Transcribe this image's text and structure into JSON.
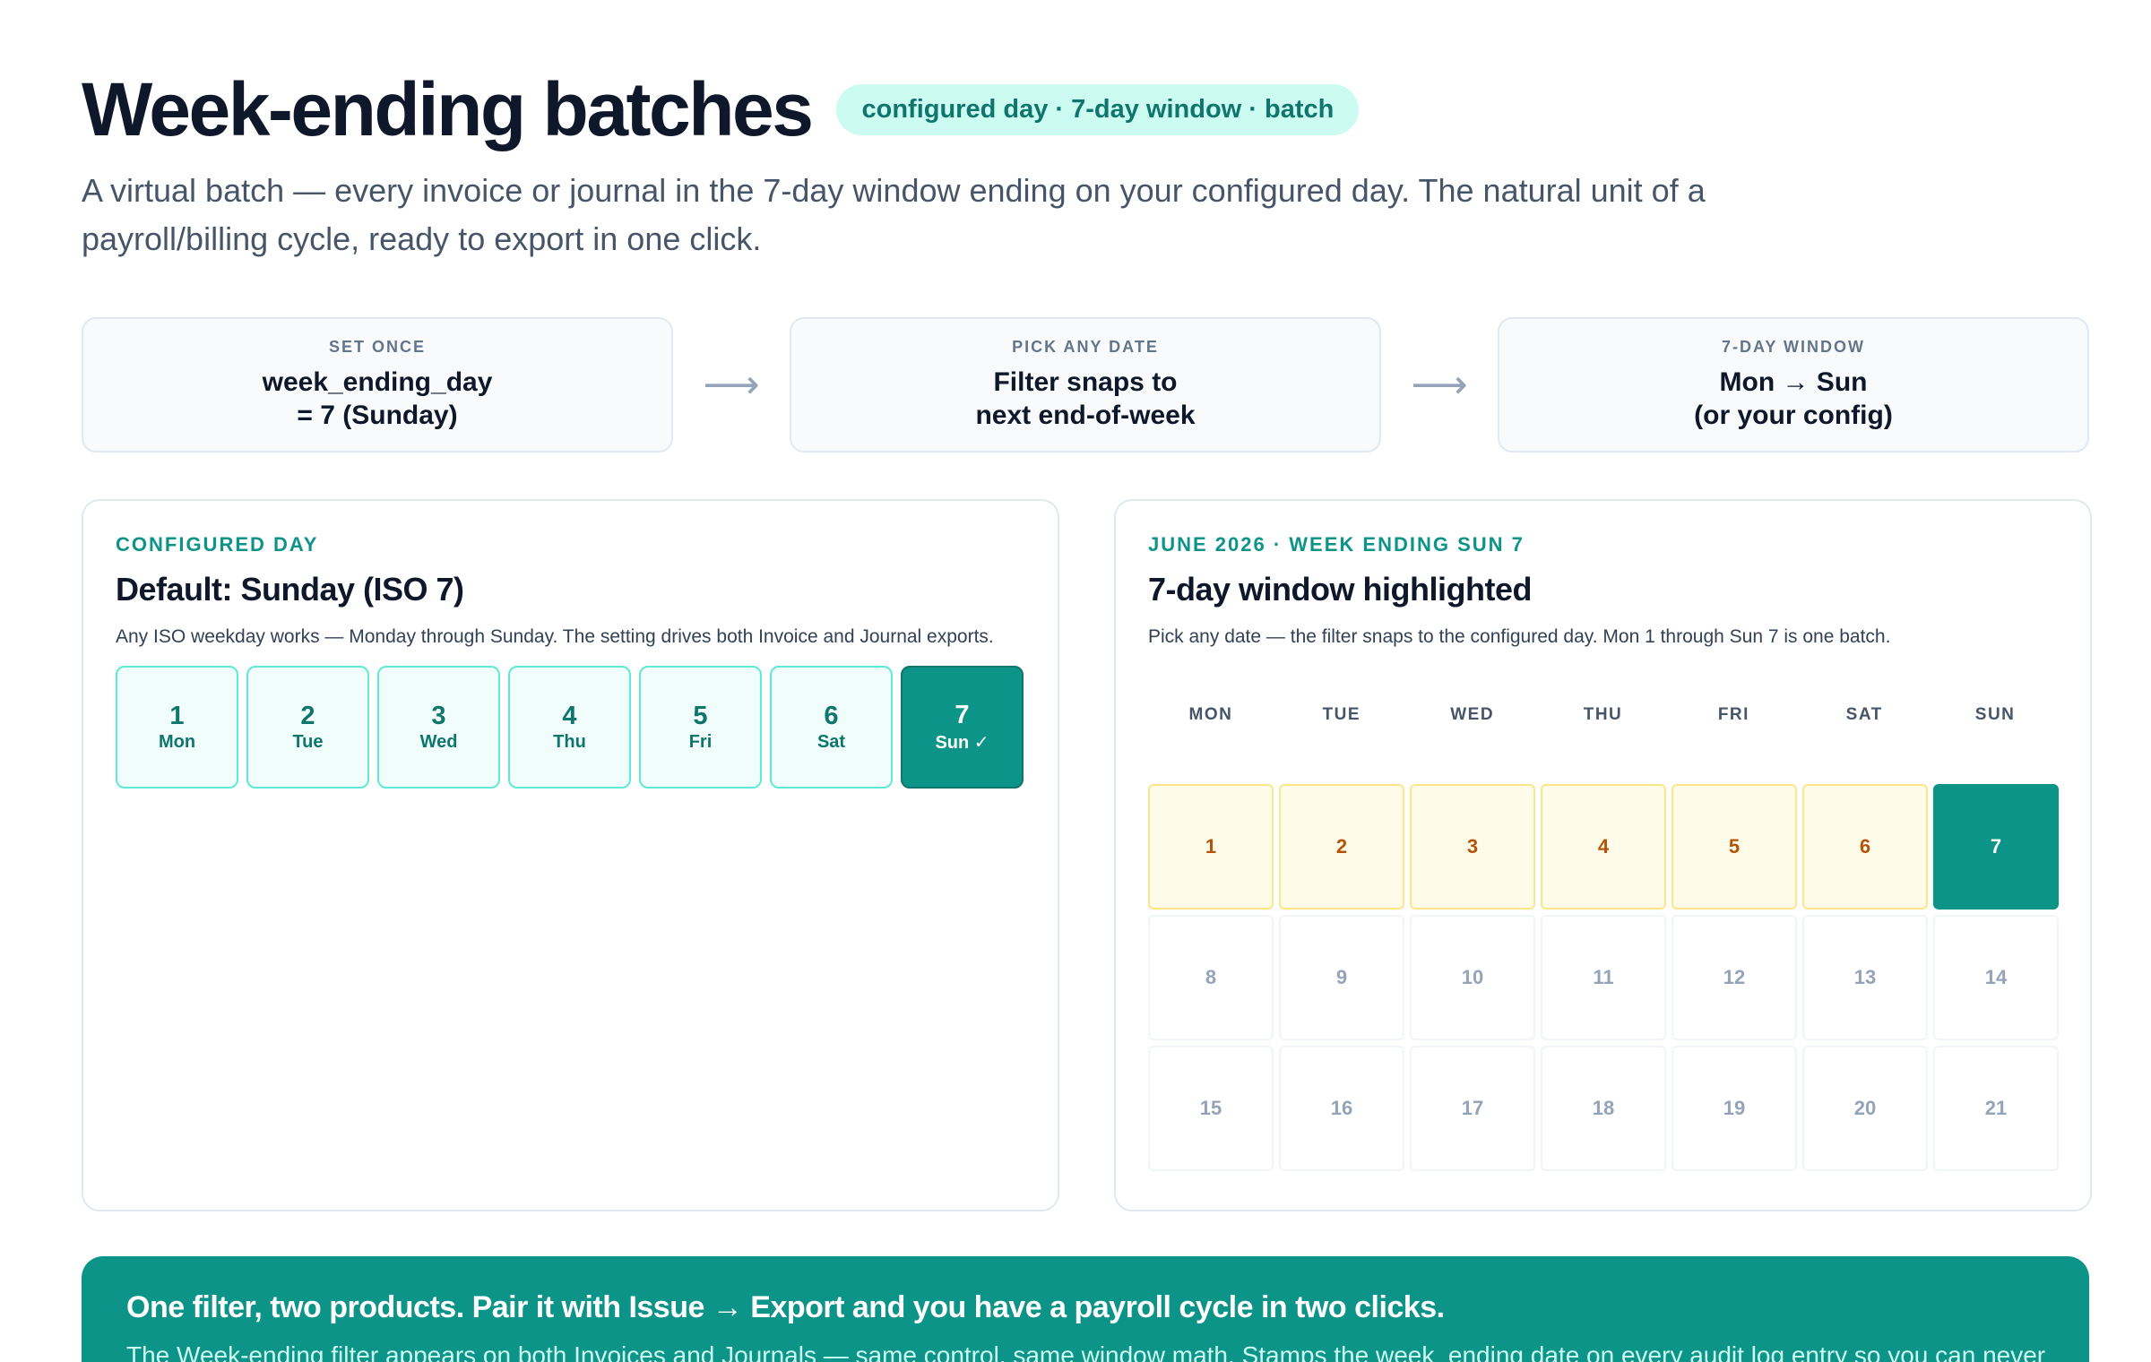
{
  "header": {
    "title": "Week-ending batches",
    "pill": "configured day · 7-day window · batch",
    "subtitle": "A virtual batch — every invoice or journal in the 7-day window ending on your configured day. The natural unit of a payroll/billing cycle, ready to export in one click."
  },
  "steps": [
    {
      "kicker": "SET ONCE",
      "line1": "week_ending_day",
      "line2": "= 7 (Sunday)"
    },
    {
      "kicker": "PICK ANY DATE",
      "line1": "Filter snaps to",
      "line2": "next end-of-week"
    },
    {
      "kicker": "7-DAY WINDOW",
      "line1": "Mon → Sun",
      "line2": "(or your config)"
    }
  ],
  "arrow_glyph": "⟶",
  "configured_day": {
    "kicker": "CONFIGURED DAY",
    "title": "Default: Sunday (ISO 7)",
    "desc": "Any ISO weekday works — Monday through Sunday. The setting drives both Invoice and Journal exports.",
    "days": [
      {
        "num": "1",
        "label": "Mon"
      },
      {
        "num": "2",
        "label": "Tue"
      },
      {
        "num": "3",
        "label": "Wed"
      },
      {
        "num": "4",
        "label": "Thu"
      },
      {
        "num": "5",
        "label": "Fri"
      },
      {
        "num": "6",
        "label": "Sat"
      },
      {
        "num": "7",
        "label": "Sun ✓"
      }
    ],
    "selected_index": 6
  },
  "calendar": {
    "kicker": "JUNE 2026 · WEEK ENDING SUN 7",
    "title": "7-day window highlighted",
    "desc": "Pick any date — the filter snaps to the configured day. Mon 1 through Sun 7 is one batch.",
    "weekdays": [
      "MON",
      "TUE",
      "WED",
      "THU",
      "FRI",
      "SAT",
      "SUN"
    ],
    "weeks": [
      [
        "1",
        "2",
        "3",
        "4",
        "5",
        "6",
        "7"
      ],
      [
        "8",
        "9",
        "10",
        "11",
        "12",
        "13",
        "14"
      ],
      [
        "15",
        "16",
        "17",
        "18",
        "19",
        "20",
        "21"
      ]
    ],
    "window_days": [
      "1",
      "2",
      "3",
      "4",
      "5",
      "6"
    ],
    "week_end_day": "7"
  },
  "banner": {
    "title": "One filter, two products. Pair it with Issue → Export and you have a payroll cycle in two clicks.",
    "text": "The Week-ending filter appears on both Invoices and Journals — same control, same window math. Stamps the week_ending date on every audit log entry so you can never"
  },
  "colors": {
    "accent": "#0d9488",
    "pill_bg": "#ccfbf1",
    "window_bg": "#fefce8",
    "window_text": "#b45309"
  }
}
